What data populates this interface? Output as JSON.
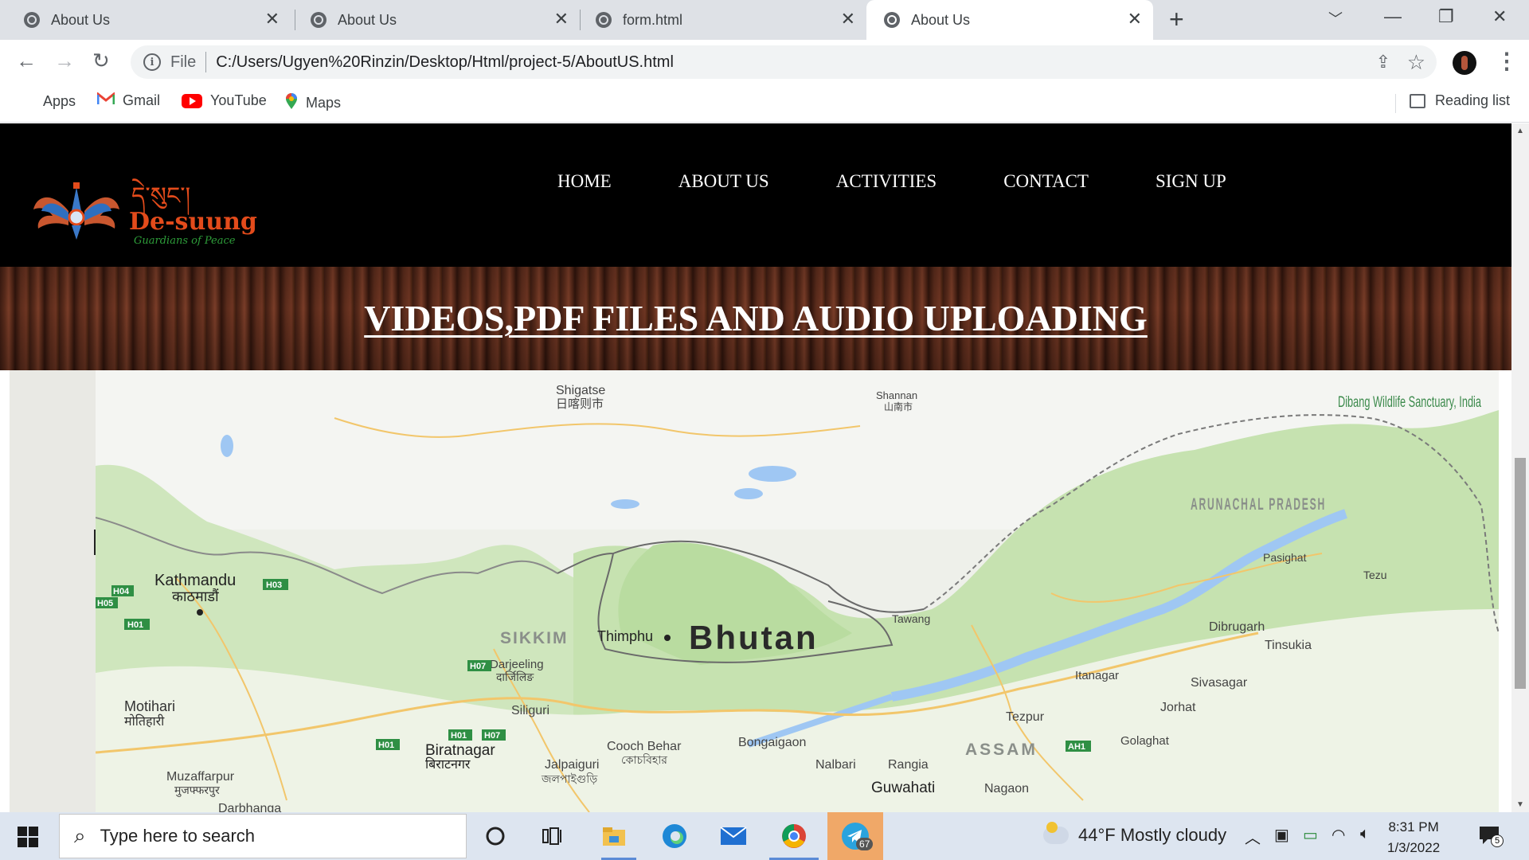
{
  "browser": {
    "tabs": [
      {
        "title": "About Us",
        "active": false
      },
      {
        "title": "About Us",
        "active": false
      },
      {
        "title": "form.html",
        "active": false
      },
      {
        "title": "About Us",
        "active": true
      }
    ],
    "omnibox": {
      "scheme_label": "File",
      "url": "C:/Users/Ugyen%20Rinzin/Desktop/Html/project-5/AboutUS.html"
    },
    "bookmarks": [
      {
        "label": "Apps",
        "icon": "apps-grid-icon"
      },
      {
        "label": "Gmail",
        "icon": "gmail-icon"
      },
      {
        "label": "YouTube",
        "icon": "youtube-icon"
      },
      {
        "label": "Maps",
        "icon": "maps-pin-icon"
      }
    ],
    "reading_list": "Reading list"
  },
  "site": {
    "logo": {
      "script_text": "དེ་སུང་།",
      "name": "De-suung",
      "tagline": "Guardians of Peace"
    },
    "nav": [
      "HOME",
      "ABOUT US",
      "ACTIVITIES",
      "CONTACT",
      "SIGN UP"
    ],
    "banner_title": "VIDEOS,PDF FILES AND AUDIO UPLOADING",
    "map": {
      "country_label": "Bhutan",
      "labels": [
        {
          "text": "Shigatse",
          "sub": "日喀则市"
        },
        {
          "text": "Shannan",
          "sub": "山南市"
        },
        {
          "text": "Dibang Wildlife Sanctuary, India"
        },
        {
          "text": "ARUNACHAL PRADESH"
        },
        {
          "text": "Pasighat"
        },
        {
          "text": "Tezu"
        },
        {
          "text": "Kathmandu",
          "sub": "काठमाडौं"
        },
        {
          "text": "SIKKIM"
        },
        {
          "text": "Thimphu"
        },
        {
          "text": "Tawang"
        },
        {
          "text": "Dibrugarh"
        },
        {
          "text": "Tinsukia"
        },
        {
          "text": "Darjeeling",
          "sub": "दार्जिलिङ"
        },
        {
          "text": "Itanagar"
        },
        {
          "text": "Sivasagar"
        },
        {
          "text": "Motihari",
          "sub": "मोतिहारी"
        },
        {
          "text": "Siliguri"
        },
        {
          "text": "Tezpur"
        },
        {
          "text": "Jorhat"
        },
        {
          "text": "Biratnagar",
          "sub": "बिराटनगर"
        },
        {
          "text": "Cooch Behar",
          "sub": "কোচবিহার"
        },
        {
          "text": "Bongaigaon"
        },
        {
          "text": "ASSAM"
        },
        {
          "text": "Golaghat"
        },
        {
          "text": "Jalpaiguri",
          "sub": "জলপাইগুড়ি"
        },
        {
          "text": "Nalbari"
        },
        {
          "text": "Rangia"
        },
        {
          "text": "Guwahati"
        },
        {
          "text": "Nagaon"
        },
        {
          "text": "Muzaffarpur",
          "sub": "मुजफ्फरपुर"
        },
        {
          "text": "Darbhanga"
        }
      ],
      "highway_badges": [
        "H04",
        "H05",
        "H03",
        "H01",
        "H07",
        "H01",
        "H01",
        "H07",
        "AH1"
      ]
    }
  },
  "taskbar": {
    "search_placeholder": "Type here to search",
    "weather": "44°F  Mostly cloudy",
    "time": "8:31 PM",
    "date": "1/3/2022",
    "telegram_badge": "67",
    "notification_count": "5"
  },
  "colors": {
    "site_header_bg": "#000000",
    "logo_red": "#e34b1b",
    "logo_green": "#2e9e3a",
    "map_land": "#e9ece4",
    "map_green": "#b9dca0",
    "map_water": "#9fc7f3",
    "highway_green": "#2f8f44"
  }
}
